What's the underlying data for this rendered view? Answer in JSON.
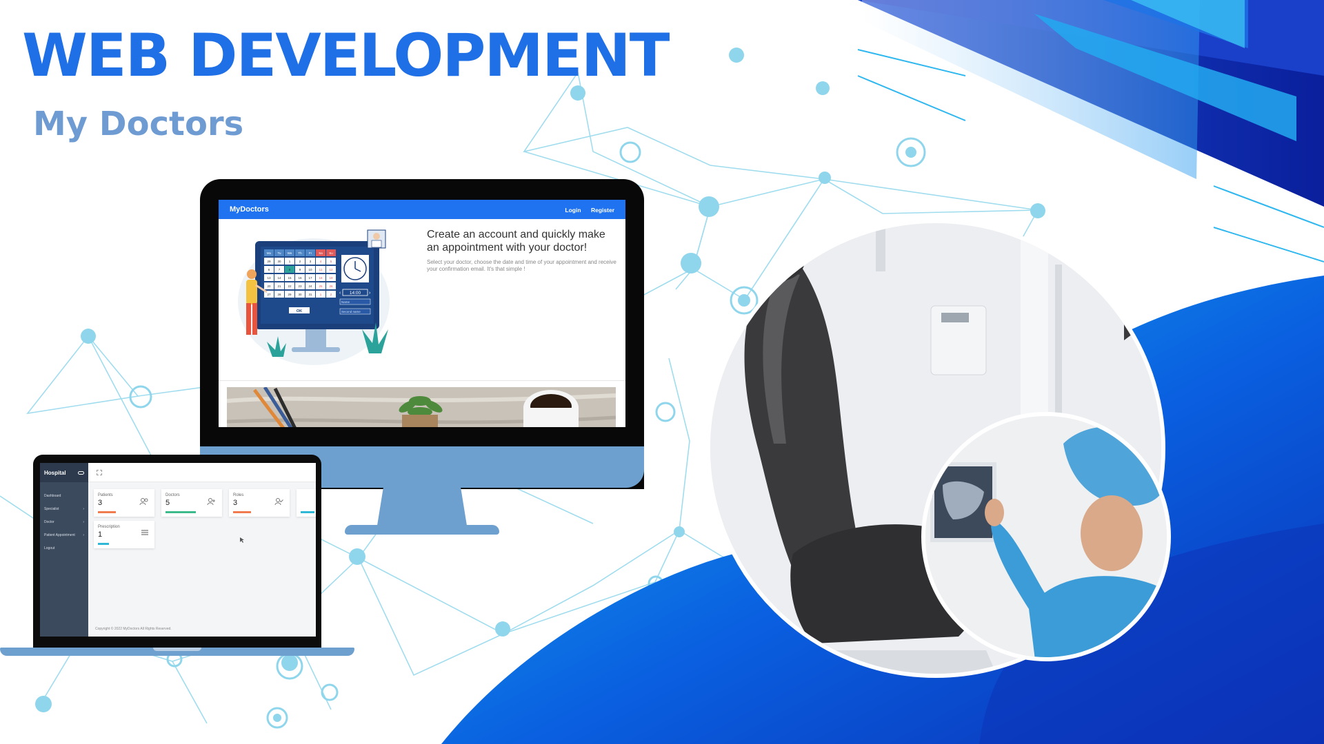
{
  "banner": {
    "headline": "WEB DEVELOPMENT",
    "subheadline": "My Doctors"
  },
  "desktop_site": {
    "brand": "MyDoctors",
    "nav": {
      "login": "Login",
      "register": "Register"
    },
    "hero_heading": "Create an account and quickly make an appointment with your doctor!",
    "hero_text": "Select your doctor, choose the date and time of your appointment and receive your confirmation email. It's that simple !",
    "calendar": {
      "weekdays": [
        "Mo",
        "Tu",
        "We",
        "Th",
        "Fr",
        "Sa",
        "Su"
      ],
      "days": [
        "29",
        "30",
        "1",
        "2",
        "3",
        "4",
        "5",
        "6",
        "7",
        "8",
        "9",
        "10",
        "11",
        "12",
        "13",
        "14",
        "15",
        "16",
        "17",
        "18",
        "19",
        "20",
        "21",
        "22",
        "23",
        "24",
        "25",
        "26",
        "27",
        "28",
        "29",
        "30",
        "31",
        "1",
        "2"
      ],
      "selected_day": "8",
      "time": "14:00",
      "name_placeholder": "Name",
      "second_name_placeholder": "Second name",
      "ok_label": "OK"
    }
  },
  "dashboard": {
    "brand": "Hospital",
    "sidebar": [
      {
        "label": "Dashboard",
        "chevron": false
      },
      {
        "label": "Specialist",
        "chevron": true
      },
      {
        "label": "Doctor",
        "chevron": true
      },
      {
        "label": "Patient Appointment",
        "chevron": true
      },
      {
        "label": "Logout",
        "chevron": false
      }
    ],
    "cards": [
      {
        "label": "Patients",
        "value": "3",
        "color": "#f07b4f",
        "icon": "users-icon"
      },
      {
        "label": "Doctors",
        "value": "5",
        "color": "#3cba8b",
        "icon": "user-plus-icon"
      },
      {
        "label": "Roles",
        "value": "3",
        "color": "#f07b4f",
        "icon": "user-check-icon"
      },
      {
        "label": "Prescription",
        "value": "1",
        "color": "#2eb8d6",
        "icon": "list-icon"
      }
    ],
    "footer": "Copyright © 2022 MyDoctors All Rights Reserved."
  },
  "colors": {
    "brand_blue": "#1f6fe6",
    "sub_blue": "#6f9bd3",
    "nav_blue": "#1f73f0",
    "device_blue": "#6d9fcf"
  }
}
